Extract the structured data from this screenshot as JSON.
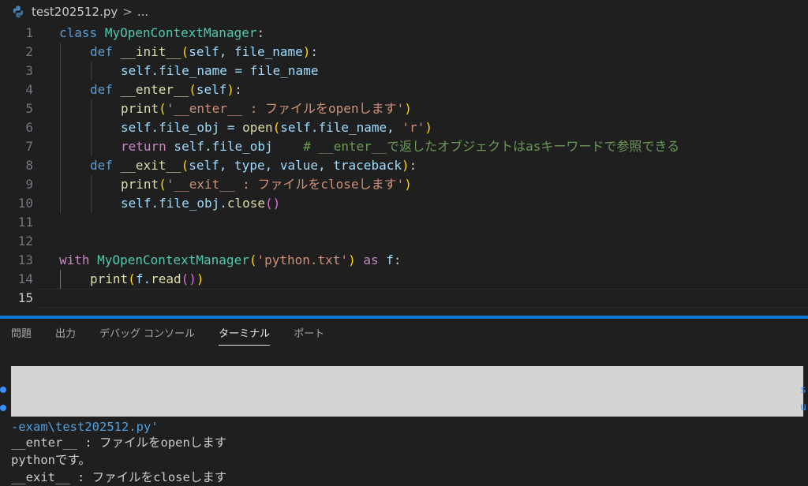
{
  "breadcrumb": {
    "file": "test202512.py",
    "separator": ">",
    "more": "..."
  },
  "editor": {
    "active_line": "15",
    "line_numbers": [
      "1",
      "2",
      "3",
      "4",
      "5",
      "6",
      "7",
      "8",
      "9",
      "10",
      "11",
      "12",
      "13",
      "14",
      "15"
    ]
  },
  "code": {
    "l1": {
      "kw": "class",
      "name": "MyOpenContextManager",
      "colon": ":"
    },
    "l2": {
      "kw": "def",
      "fn": "__init__",
      "lp": "(",
      "p1": "self",
      "comma": ", ",
      "p2": "file_name",
      "rp": ")",
      "colon": ":"
    },
    "l3": {
      "text": "self.file_name = file_name"
    },
    "l4": {
      "kw": "def",
      "fn": "__enter__",
      "lp": "(",
      "p1": "self",
      "rp": ")",
      "colon": ":"
    },
    "l5": {
      "fn": "print",
      "lp": "(",
      "str": "'__enter__ : ファイルをopenします'",
      "rp": ")"
    },
    "l6": {
      "lhs": "self.file_obj = ",
      "fn": "open",
      "lp": "(",
      "arg": "self.file_name, ",
      "str": "'r'",
      "rp": ")"
    },
    "l7": {
      "kw": "return",
      "val": " self.file_obj",
      "comment": "# __enter__で返したオブジェクトはasキーワードで参照できる"
    },
    "l8": {
      "kw": "def",
      "fn": "__exit__",
      "lp": "(",
      "params": "self, type, value, traceback",
      "rp": ")",
      "colon": ":"
    },
    "l9": {
      "fn": "print",
      "lp": "(",
      "str": "'__exit__ : ファイルをcloseします'",
      "rp": ")"
    },
    "l10": {
      "obj": "self.file_obj.",
      "fn": "close",
      "parens": "()"
    },
    "l13": {
      "kw": "with",
      "cls": "MyOpenContextManager",
      "lp": "(",
      "str": "'python.txt'",
      "rp": ")",
      "as": "as",
      "var": "f",
      "colon": ":"
    },
    "l14": {
      "fn": "print",
      "lp": "(",
      "obj": "f.",
      "fn2": "read",
      "inner": "()",
      "rp": ")"
    }
  },
  "panel": {
    "tabs": [
      "問題",
      "出力",
      "デバッグ コンソール",
      "ターミナル",
      "ポート"
    ],
    "active_tab": "ターミナル"
  },
  "terminal": {
    "path_line": "-exam\\test202512.py'",
    "out1": "__enter__ : ファイルをopenします",
    "out2": "pythonです。",
    "out3": "__exit__ : ファイルをcloseします",
    "edge_s": "s",
    "edge_u": "u"
  },
  "colors": {
    "accent": "#0078d4",
    "keyword": "#569cd6",
    "control": "#c586c0",
    "function": "#dcdcaa",
    "class": "#4ec9b0",
    "string": "#ce9178",
    "comment": "#6a9955",
    "variable": "#9cdcfe",
    "bracket1": "#ffd700",
    "bracket2": "#da70d6"
  },
  "icons": {
    "file_type": "python-icon",
    "status_dot": "terminal-dot-icon"
  }
}
